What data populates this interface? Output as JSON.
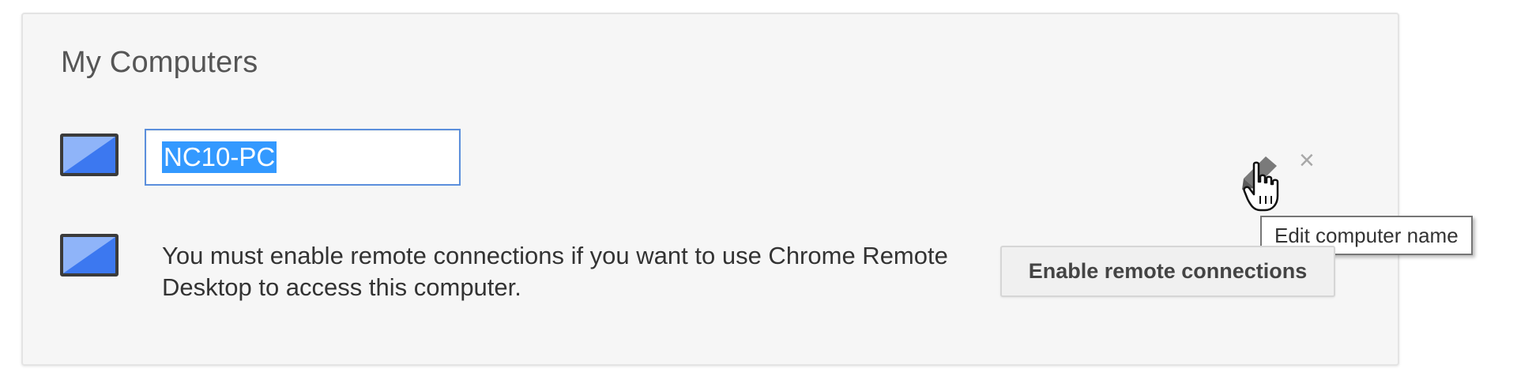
{
  "section": {
    "title": "My Computers"
  },
  "host_row": {
    "icon": "computer-icon",
    "name_value": "NC10-PC",
    "edit_icon": "pencil-icon",
    "delete_icon": "close-icon",
    "delete_glyph": "×",
    "tooltip": "Edit computer name"
  },
  "local_row": {
    "icon": "computer-icon",
    "message": "You must enable remote connections if you want to use Chrome Remote Desktop to access this computer.",
    "enable_button_label": "Enable remote connections"
  },
  "colors": {
    "panel_background": "#f6f6f6",
    "input_border": "#5b8fdc",
    "selection": "#3399ff",
    "icon_blue": "#3c78f0"
  }
}
